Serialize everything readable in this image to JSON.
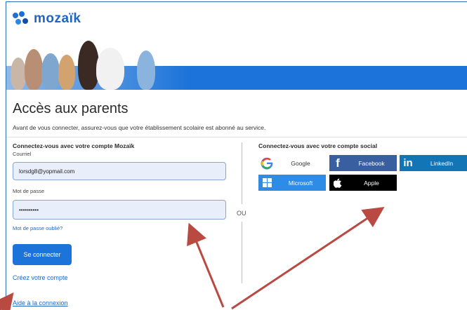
{
  "brand": {
    "name": "mozaïk"
  },
  "page": {
    "title": "Accès aux parents",
    "intro": "Avant de vous connecter, assurez-vous que votre établissement scolaire est abonné au service."
  },
  "login": {
    "heading": "Connectez-vous avec votre compte Mozaïk",
    "email_label": "Courriel",
    "email_value": "lorsdg8@yopmail.com",
    "password_label": "Mot de passe",
    "password_value": "••••••••••",
    "forgot_link": "Mot de passe oublié?",
    "submit_label": "Se connecter",
    "create_link": "Créez votre compte",
    "help_link": "Aide à la connexion"
  },
  "separator": "OU",
  "social": {
    "heading": "Connectez-vous avec votre compte social",
    "buttons": [
      {
        "label": "Google",
        "icon": "google-icon"
      },
      {
        "label": "Facebook",
        "icon": "facebook-icon"
      },
      {
        "label": "LinkedIn",
        "icon": "linkedin-icon"
      },
      {
        "label": "Microsoft",
        "icon": "microsoft-icon"
      },
      {
        "label": "Apple",
        "icon": "apple-icon"
      }
    ]
  },
  "colors": {
    "brand_blue": "#1c73d9",
    "annotation_arrow": "#b84a42"
  }
}
